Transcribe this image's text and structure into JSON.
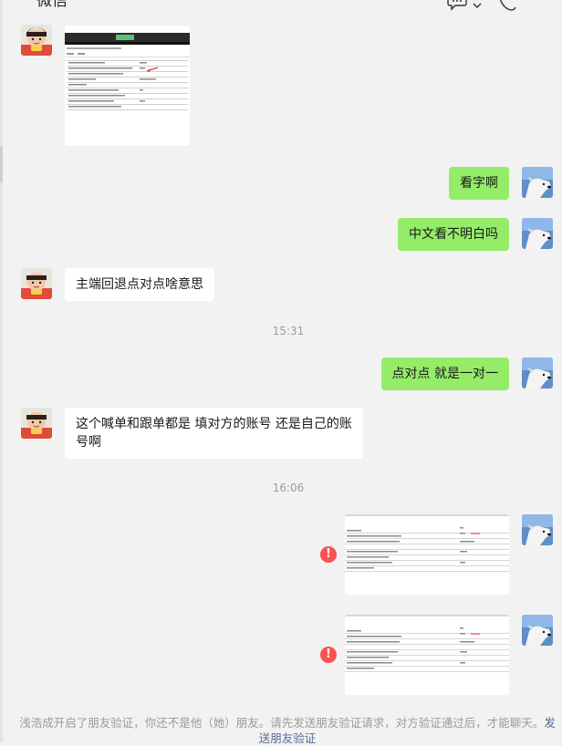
{
  "header": {
    "title": "微信"
  },
  "messages": {
    "m2": {
      "text": "看字啊"
    },
    "m3": {
      "text": "中文看不明白吗"
    },
    "m4": {
      "text": "主端回退点对点啥意思"
    },
    "t1": {
      "text": "15:31"
    },
    "m5": {
      "text": "点对点 就是一对一"
    },
    "m6": {
      "text": "这个喊单和跟单都是 填对方的账号 还是自己的账号啊"
    },
    "t2": {
      "text": "16:06"
    },
    "m7": {
      "failed": true
    },
    "m8": {
      "failed": true
    }
  },
  "footer": {
    "notice": "浅浩成开启了朋友验证，你还不是他（她）朋友。请先发送朋友验证请求，对方验证通过后，才能聊天。",
    "link": "发送朋友验证"
  },
  "colors": {
    "out_bubble": "#95ec69",
    "in_bubble": "#ffffff",
    "error": "#fa5151",
    "link": "#576b95"
  }
}
